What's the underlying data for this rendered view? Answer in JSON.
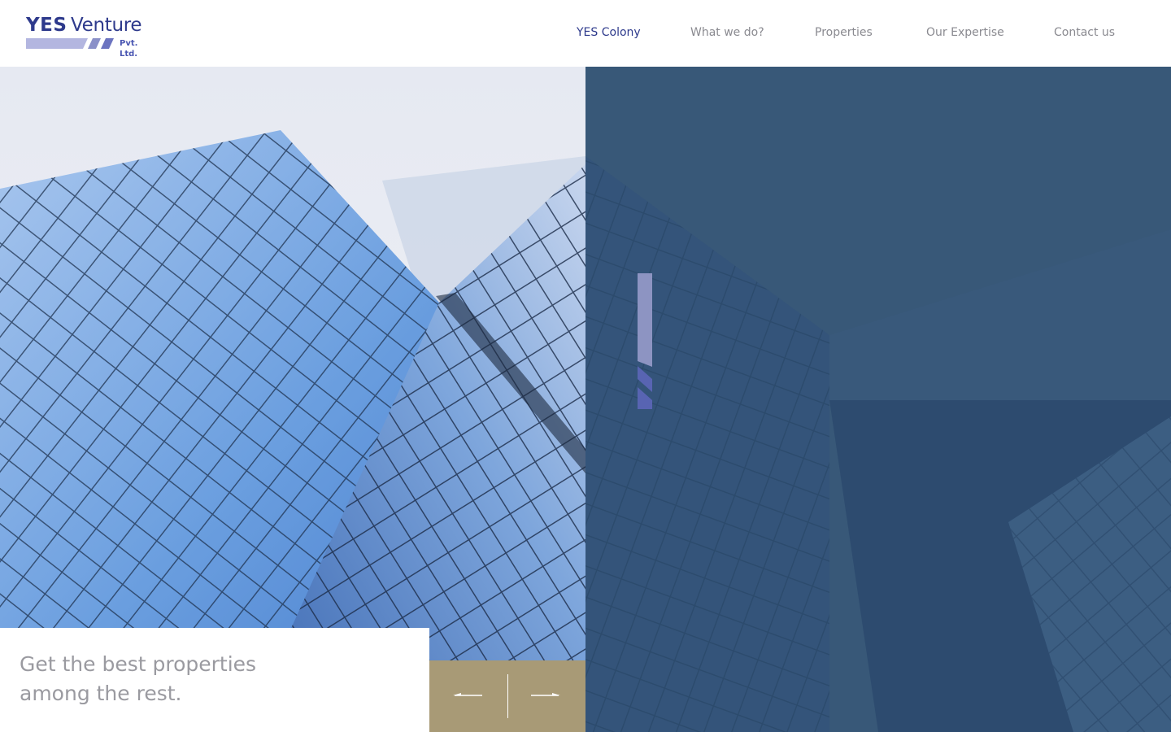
{
  "brand": {
    "name_bold": "YES",
    "name_regular": "Venture",
    "suffix": "Pvt. Ltd.",
    "primary_color": "#2e3a8c",
    "secondary_color": "#b3b6e0"
  },
  "nav": {
    "items": [
      {
        "label": "YES Colony",
        "active": true
      },
      {
        "label": "What we do?",
        "active": false
      },
      {
        "label": "Properties",
        "active": false
      },
      {
        "label": "Our Expertise",
        "active": false
      },
      {
        "label": "Contact us",
        "active": false
      }
    ],
    "active_color": "#2e3a8c",
    "inactive_color": "#8a8a90"
  },
  "hero": {
    "caption_line1": "Get the best properties",
    "caption_line2": "among the rest.",
    "overlay_color": "#385878",
    "accent_color": "#a89a76"
  },
  "slider": {
    "prev_icon": "arrow-left-icon",
    "next_icon": "arrow-right-icon"
  }
}
